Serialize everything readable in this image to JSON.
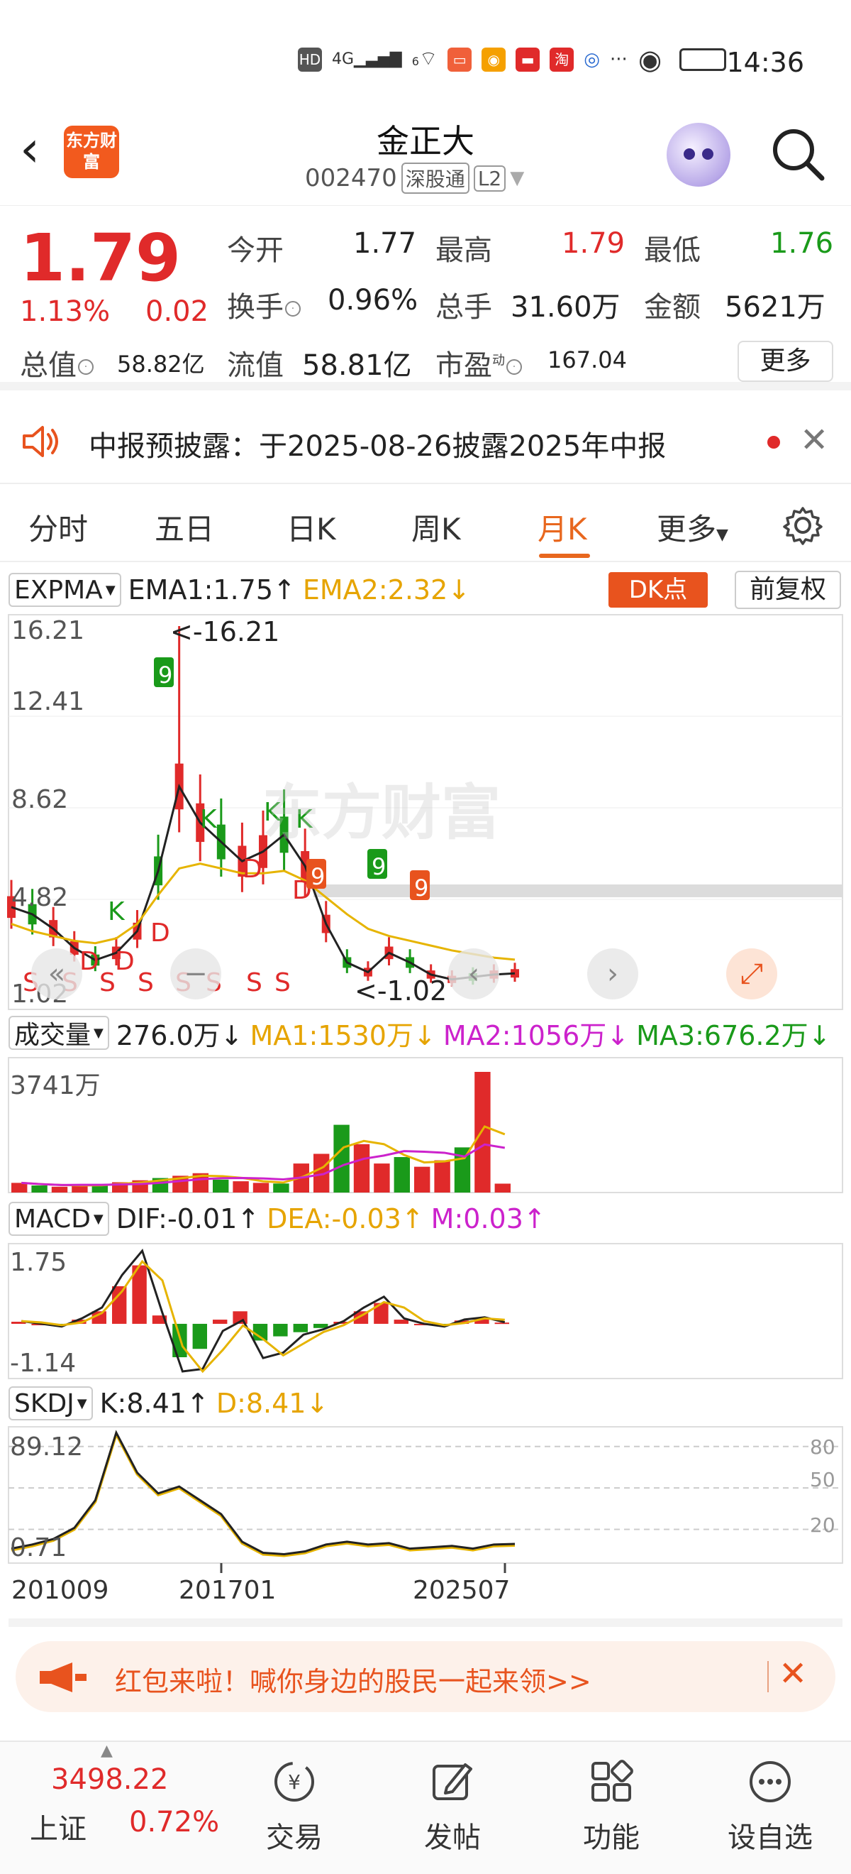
{
  "status_bar": {
    "time": "14:36",
    "hd": "HD",
    "signal": "4G",
    "wifi": "6"
  },
  "header": {
    "app_logo": "东方财富",
    "stock_name": "金正大",
    "stock_code": "002470",
    "connect_tag": "深股通",
    "level_tag": "L2"
  },
  "quote": {
    "price": "1.79",
    "change_pct": "1.13%",
    "change": "0.02",
    "open_label": "今开",
    "open": "1.77",
    "high_label": "最高",
    "high": "1.79",
    "low_label": "最低",
    "low": "1.76",
    "turnover_label": "换手",
    "turnover": "0.96%",
    "volume_label": "总手",
    "volume": "31.60万",
    "amount_label": "金额",
    "amount": "5621万",
    "mktcap_label": "总值",
    "mktcap": "58.82亿",
    "float_label": "流值",
    "float_cap": "58.81亿",
    "pe_label": "市盈",
    "pe_sup": "动",
    "pe": "167.04",
    "more_label": "更多"
  },
  "notice": {
    "text": "中报预披露：于2025-08-26披露2025年中报"
  },
  "tabs": [
    {
      "label": "分时"
    },
    {
      "label": "五日"
    },
    {
      "label": "日K"
    },
    {
      "label": "周K"
    },
    {
      "label": "月K"
    },
    {
      "label": "更多"
    }
  ],
  "indicators": {
    "expma": {
      "name": "EXPMA",
      "ema1": "EMA1:1.75↑",
      "ema2": "EMA2:2.32↓",
      "dk": "DK点",
      "adjust": "前复权"
    },
    "vol": {
      "name": "成交量",
      "cur": "276.0万↓",
      "ma1": "MA1:1530万↓",
      "ma2": "MA2:1056万↓",
      "ma3": "MA3:676.2万↓"
    },
    "macd": {
      "name": "MACD",
      "dif": "DIF:-0.01↑",
      "dea": "DEA:-0.03↑",
      "m": "M:0.03↑"
    },
    "skdj": {
      "name": "SKDJ",
      "k": "K:8.41↑",
      "d": "D:8.41↓"
    }
  },
  "chart_data": [
    {
      "type": "line",
      "title": "",
      "ylabels": [
        "16.21",
        "12.41",
        "8.62",
        "4.82",
        "1.02"
      ],
      "max_annotation": "<-16.21",
      "min_annotation": "<-1.02",
      "watermark": "东方财富",
      "series": [
        {
          "name": "EMA1",
          "color": "#222222",
          "values": [
            4.5,
            4.2,
            3.6,
            2.8,
            2.3,
            2.6,
            3.5,
            6.0,
            9.5,
            8.0,
            7.2,
            6.4,
            6.8,
            7.5,
            6.2,
            3.8,
            2.2,
            1.8,
            2.6,
            2.2,
            1.7,
            1.5,
            1.6,
            1.7,
            1.75
          ]
        },
        {
          "name": "EMA2",
          "color": "#e6b400",
          "values": [
            3.8,
            3.5,
            3.3,
            3.1,
            3.0,
            3.2,
            3.8,
            5.0,
            6.1,
            6.3,
            6.1,
            5.9,
            5.9,
            6.0,
            5.6,
            4.9,
            4.2,
            3.6,
            3.3,
            3.1,
            2.9,
            2.7,
            2.55,
            2.4,
            2.32
          ]
        }
      ],
      "signals": [
        "S",
        "S",
        "S",
        "S",
        "S",
        "S",
        "S",
        "S",
        "D",
        "D",
        "D",
        "D",
        "D",
        "K",
        "K",
        "K",
        "K",
        "9",
        "9",
        "9",
        "9"
      ]
    },
    {
      "type": "bar",
      "title": "",
      "ylabels": [
        "3741万"
      ],
      "values": [
        300,
        220,
        180,
        260,
        240,
        320,
        380,
        450,
        520,
        600,
        400,
        350,
        300,
        280,
        900,
        1200,
        2100,
        1500,
        900,
        1100,
        800,
        1000,
        1400,
        3741,
        276
      ]
    },
    {
      "type": "bar",
      "title": "",
      "ylabels": [
        "1.75",
        "-1.14"
      ],
      "values": [
        0.05,
        0.0,
        -0.05,
        0.1,
        0.3,
        0.9,
        1.4,
        0.2,
        -0.8,
        -0.6,
        0.1,
        0.3,
        -0.4,
        -0.3,
        -0.2,
        -0.1,
        0.05,
        0.3,
        0.5,
        0.1,
        0.0,
        -0.05,
        0.08,
        0.12,
        0.03
      ]
    },
    {
      "type": "line",
      "title": "",
      "ylabels": [
        "89.12",
        "0.71"
      ],
      "right_labels": [
        "80",
        "50",
        "20"
      ],
      "x": [
        "201009",
        "201701",
        "202507"
      ],
      "values": [
        5,
        8,
        12,
        20,
        40,
        89,
        60,
        45,
        50,
        40,
        30,
        10,
        2,
        1,
        3,
        8,
        10,
        8,
        9,
        5,
        6,
        7,
        5,
        8,
        8.41
      ]
    }
  ],
  "ad_banner": {
    "text": "红包来啦！喊你身边的股民一起来领>>"
  },
  "bottom_nav": {
    "index_value": "3498.22",
    "index_name": "上证",
    "index_change": "0.72%",
    "items": [
      {
        "label": "交易",
        "icon": "trade-icon"
      },
      {
        "label": "发帖",
        "icon": "post-icon"
      },
      {
        "label": "功能",
        "icon": "grid-icon"
      },
      {
        "label": "设自选",
        "icon": "more-dots-icon"
      }
    ]
  }
}
